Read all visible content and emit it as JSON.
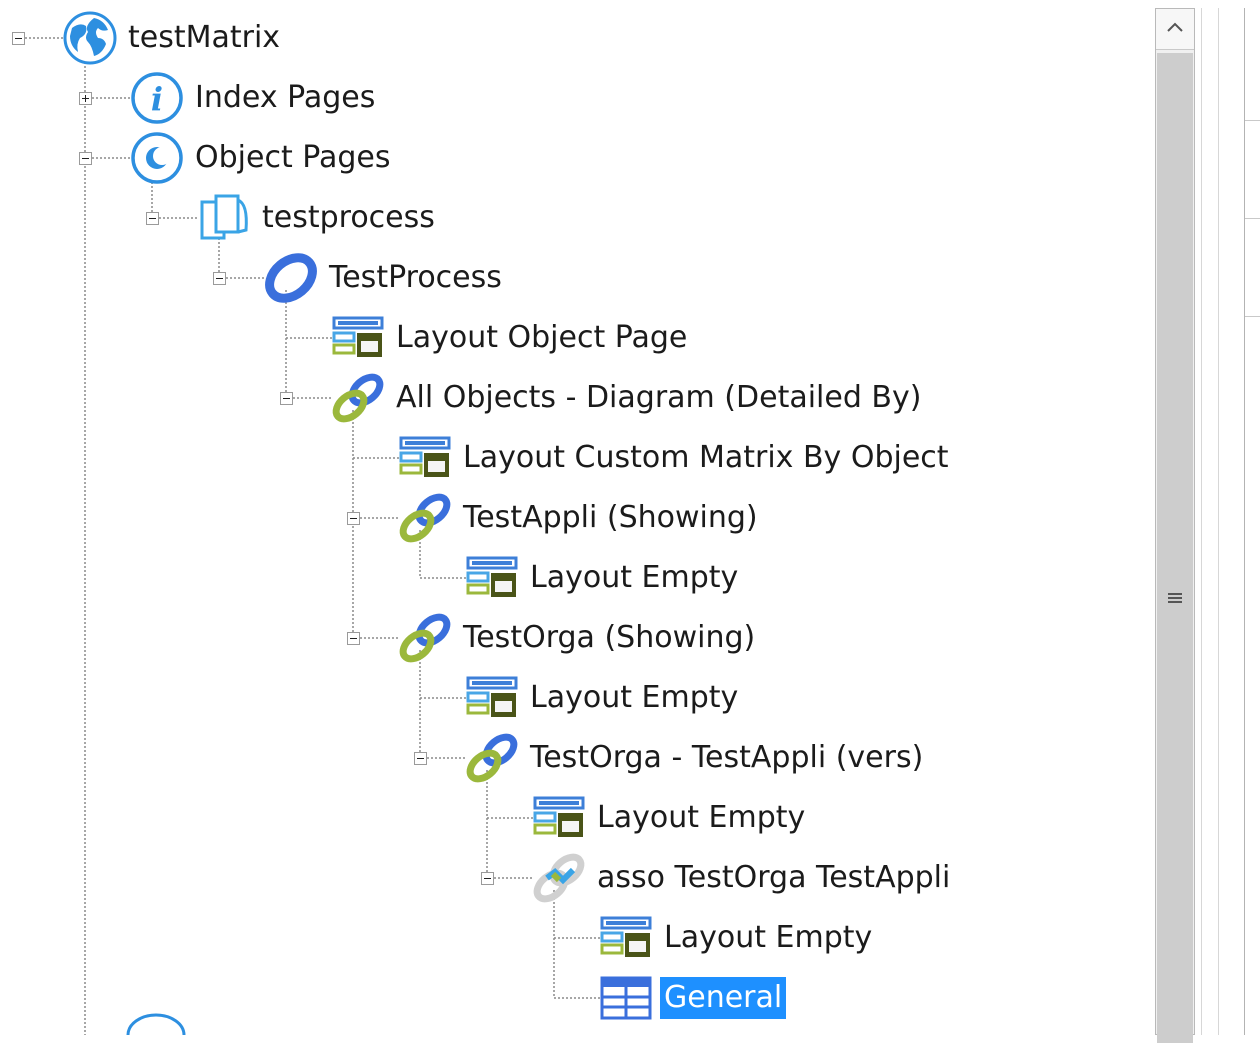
{
  "tree": {
    "nodes": [
      {
        "name": "tree-node-testmatrix",
        "label": "testMatrix",
        "icon": "globe-icon",
        "expander": "expanded",
        "selected": false
      },
      {
        "name": "tree-node-index-pages",
        "label": "Index Pages",
        "icon": "info-icon",
        "expander": "collapsed",
        "selected": false
      },
      {
        "name": "tree-node-object-pages",
        "label": "Object Pages",
        "icon": "object-pages-icon",
        "expander": "expanded",
        "selected": false
      },
      {
        "name": "tree-node-testprocess-folder",
        "label": "testprocess",
        "icon": "pages-icon",
        "expander": "expanded",
        "selected": false
      },
      {
        "name": "tree-node-testprocess",
        "label": "TestProcess",
        "icon": "ring-icon",
        "expander": "expanded",
        "selected": false
      },
      {
        "name": "tree-node-layout-object-page",
        "label": "Layout Object Page",
        "icon": "layout-icon",
        "expander": "none",
        "selected": false
      },
      {
        "name": "tree-node-all-objects-diagram",
        "label": "All Objects - Diagram (Detailed By)",
        "icon": "link-icon",
        "expander": "expanded",
        "selected": false
      },
      {
        "name": "tree-node-layout-custom-matrix",
        "label": "Layout Custom Matrix By Object",
        "icon": "layout-icon",
        "expander": "none",
        "selected": false
      },
      {
        "name": "tree-node-testappli-showing",
        "label": "TestAppli (Showing)",
        "icon": "link-icon",
        "expander": "expanded",
        "selected": false
      },
      {
        "name": "tree-node-layout-empty-1",
        "label": "Layout Empty",
        "icon": "layout-icon",
        "expander": "none",
        "selected": false
      },
      {
        "name": "tree-node-testorga-showing",
        "label": "TestOrga (Showing)",
        "icon": "link-icon",
        "expander": "expanded",
        "selected": false
      },
      {
        "name": "tree-node-layout-empty-2",
        "label": "Layout Empty",
        "icon": "layout-icon",
        "expander": "none",
        "selected": false
      },
      {
        "name": "tree-node-testorga-testappli",
        "label": "TestOrga - TestAppli (vers)",
        "icon": "link-icon",
        "expander": "expanded",
        "selected": false
      },
      {
        "name": "tree-node-layout-empty-3",
        "label": "Layout Empty",
        "icon": "layout-icon",
        "expander": "none",
        "selected": false
      },
      {
        "name": "tree-node-asso",
        "label": "asso TestOrga TestAppli",
        "icon": "association-icon",
        "expander": "expanded",
        "selected": false
      },
      {
        "name": "tree-node-layout-empty-4",
        "label": "Layout Empty",
        "icon": "layout-icon",
        "expander": "none",
        "selected": false
      },
      {
        "name": "tree-node-general",
        "label": "General",
        "icon": "grid-icon",
        "expander": "none",
        "selected": true
      }
    ]
  },
  "scrollbar": {
    "up_icon": "chevron-up-icon",
    "grip_icon": "grip-icon"
  },
  "colors": {
    "selection": "#1e90ff",
    "icon_blue": "#3f7fd6",
    "icon_green": "#9bb83c",
    "layout_dark": "#4a5418"
  }
}
